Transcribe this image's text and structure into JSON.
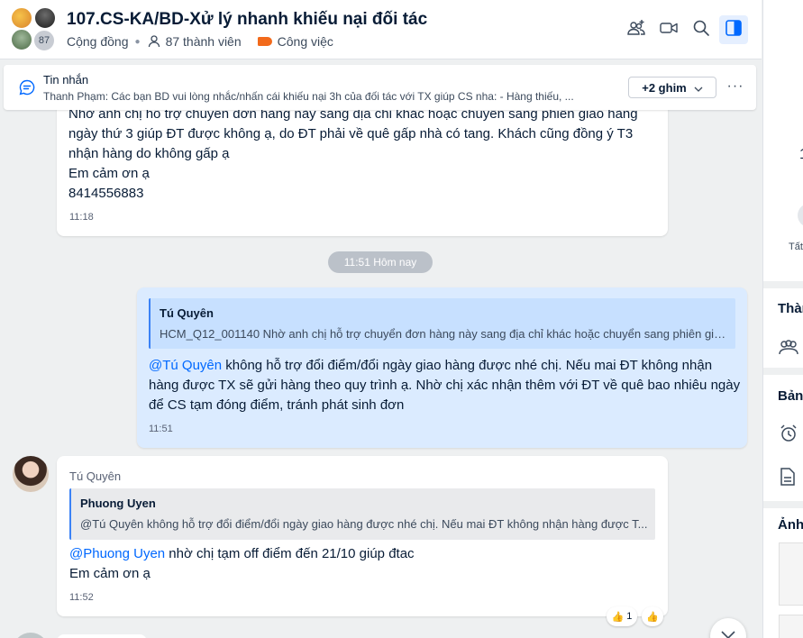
{
  "header": {
    "title": "107.CS-KA/BD-Xử lý nhanh khiếu nại đối tác",
    "member_count_badge": "87",
    "community_label": "Cộng đồng",
    "members_label": "87 thành viên",
    "label_tag": "Công việc"
  },
  "pinned": {
    "title": "Tin nhắn",
    "text": "Thanh Phạm: Các bạn BD vui lòng nhắc/nhấn cái khiếu nại 3h của đối tác với TX giúp CS nha: - Hàng thiếu, ...",
    "more_button": "+2 ghim"
  },
  "messages": [
    {
      "lines": [
        "Nhờ anh chị hỗ trợ chuyển đơn hàng này sang địa chỉ khác hoặc chuyển sang phiên giao hàng",
        "ngày thứ 3 giúp ĐT được không ạ, do ĐT phải về quê gấp nhà có tang. Khách cũng đồng ý T3",
        "nhận hàng do không gấp ạ",
        "Em cảm ơn ạ",
        "8414556883"
      ],
      "time": "11:18"
    },
    {
      "quote_name": "Tú Quyên",
      "quote_text": "HCM_Q12_001140 Nhờ anh chị hỗ trợ chuyển đơn hàng này sang địa chỉ khác hoặc chuyển sang phiên giao...",
      "mention": "@Tú Quyên",
      "line1_rest": " không hỗ trợ đổi điểm/đổi ngày giao hàng được nhé chị. Nếu mai ĐT không nhận",
      "line2": "hàng được TX sẽ gửi hàng theo quy trình ạ. Nhờ chị xác nhận thêm với ĐT về quê bao nhiêu ngày",
      "line3": "để CS tạm đóng điểm, tránh phát sinh đơn",
      "time": "11:51"
    },
    {
      "sender": "Tú Quyên",
      "quote_name": "Phuong Uyen",
      "quote_text": "@Tú Quyên không hỗ trợ đổi điểm/đổi ngày giao hàng được nhé chị. Nếu mai ĐT không nhận hàng được T...",
      "mention": "@Phuong Uyen",
      "line1_rest": " nhờ chị tạm off điểm đến 21/10 giúp đtac",
      "line2": "Em cảm ơn ạ",
      "time": "11:52",
      "reaction_count": "1"
    }
  ],
  "date_divider": "11:51 Hôm nay",
  "right_panel": {
    "number_partial": "1",
    "all_partial": "Tất",
    "members_partial": "Thàn",
    "board_partial": "Bảng",
    "images_partial": "Ảnh"
  },
  "icons": {
    "add_member": "add-member-icon",
    "video": "video-icon",
    "search": "search-icon",
    "panel": "panel-toggle-icon",
    "pinned_message": "chat-bubble-icon",
    "like": "thumbs-up-icon"
  },
  "colors": {
    "accent": "#0068ff",
    "label_tag": "#f26a1b",
    "my_bubble": "#dbebff"
  }
}
